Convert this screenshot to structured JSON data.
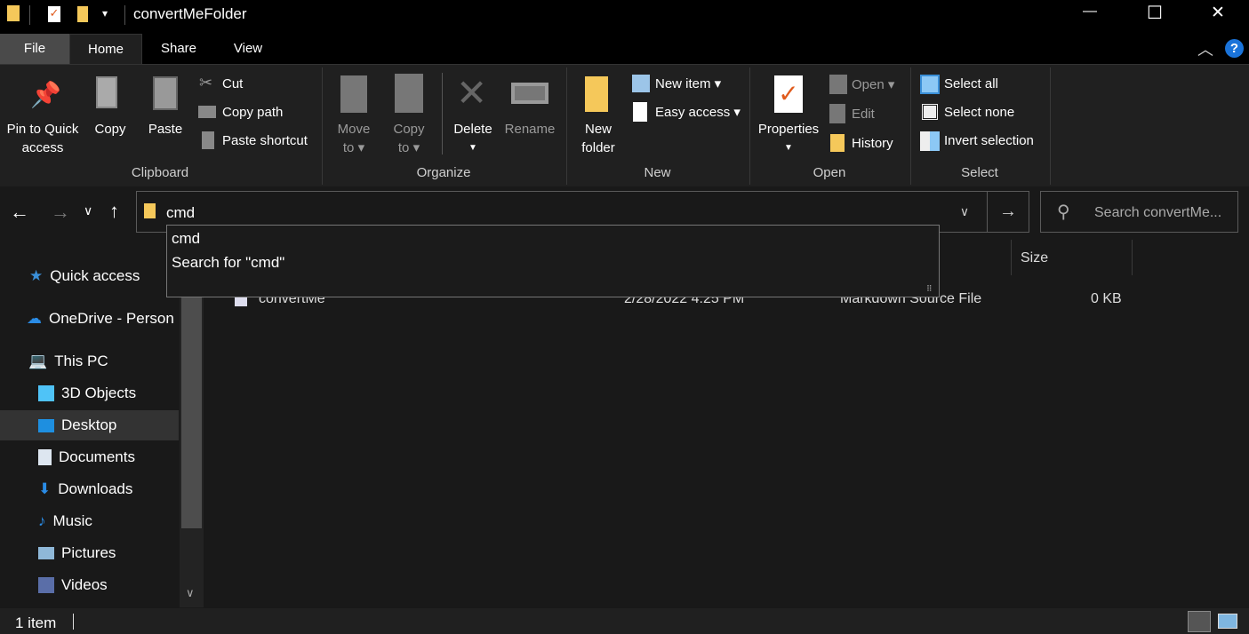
{
  "window": {
    "title": "convertMeFolder",
    "minimize": "—",
    "maximize": "☐",
    "close": "✕"
  },
  "tabs": [
    {
      "label": "File"
    },
    {
      "label": "Home"
    },
    {
      "label": "Share"
    },
    {
      "label": "View"
    }
  ],
  "ribbon": {
    "clipboard": {
      "group": "Clipboard",
      "pin": "Pin to Quick",
      "pin2": "access",
      "copy": "Copy",
      "paste": "Paste",
      "cut": "Cut",
      "copy_path": "Copy path",
      "paste_shortcut": "Paste shortcut"
    },
    "organize": {
      "group": "Organize",
      "move": "Move",
      "move2": "to",
      "copy": "Copy",
      "copy2": "to",
      "delete": "Delete",
      "rename": "Rename"
    },
    "new": {
      "group": "New",
      "new_folder": "New",
      "new_folder2": "folder",
      "new_item": "New item",
      "easy_access": "Easy access"
    },
    "open": {
      "group": "Open",
      "properties": "Properties",
      "open": "Open",
      "edit": "Edit",
      "history": "History"
    },
    "select": {
      "group": "Select",
      "select_all": "Select all",
      "select_none": "Select none",
      "invert": "Invert selection"
    }
  },
  "address": {
    "value": "cmd",
    "search_placeholder": "Search convertMe..."
  },
  "autocomplete": [
    {
      "label": "cmd"
    },
    {
      "label": "Search for \"cmd\""
    }
  ],
  "columns": {
    "size": "Size"
  },
  "files": [
    {
      "name": "convertMe",
      "date": "2/28/2022 4:25 PM",
      "type": "Markdown Source File",
      "size": "0 KB"
    }
  ],
  "sidebar": [
    {
      "label": "Quick access"
    },
    {
      "label": "OneDrive - Person"
    },
    {
      "label": "This PC"
    },
    {
      "label": "3D Objects"
    },
    {
      "label": "Desktop"
    },
    {
      "label": "Documents"
    },
    {
      "label": "Downloads"
    },
    {
      "label": "Music"
    },
    {
      "label": "Pictures"
    },
    {
      "label": "Videos"
    }
  ],
  "status": {
    "count": "1 item"
  },
  "colors": {
    "accent": "#0078d7",
    "folder": "#f5c85a"
  }
}
